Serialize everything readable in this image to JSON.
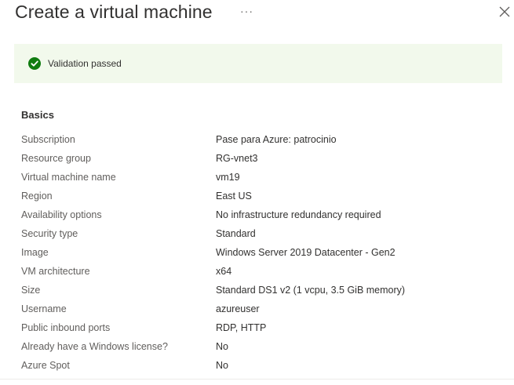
{
  "header": {
    "title": "Create a virtual machine",
    "more_label": "···"
  },
  "banner": {
    "text": "Validation passed",
    "status_color": "#107c10",
    "icon": "checkmark-circle-icon"
  },
  "basics": {
    "title": "Basics",
    "rows": [
      {
        "label": "Subscription",
        "value": "Pase para Azure: patrocinio"
      },
      {
        "label": "Resource group",
        "value": "RG-vnet3"
      },
      {
        "label": "Virtual machine name",
        "value": "vm19"
      },
      {
        "label": "Region",
        "value": "East US"
      },
      {
        "label": "Availability options",
        "value": "No infrastructure redundancy required"
      },
      {
        "label": "Security type",
        "value": "Standard"
      },
      {
        "label": "Image",
        "value": "Windows Server 2019 Datacenter - Gen2"
      },
      {
        "label": "VM architecture",
        "value": "x64"
      },
      {
        "label": "Size",
        "value": "Standard DS1 v2 (1 vcpu, 3.5 GiB memory)"
      },
      {
        "label": "Username",
        "value": "azureuser"
      },
      {
        "label": "Public inbound ports",
        "value": "RDP, HTTP"
      },
      {
        "label": "Already have a Windows license?",
        "value": "No"
      },
      {
        "label": "Azure Spot",
        "value": "No"
      }
    ]
  }
}
